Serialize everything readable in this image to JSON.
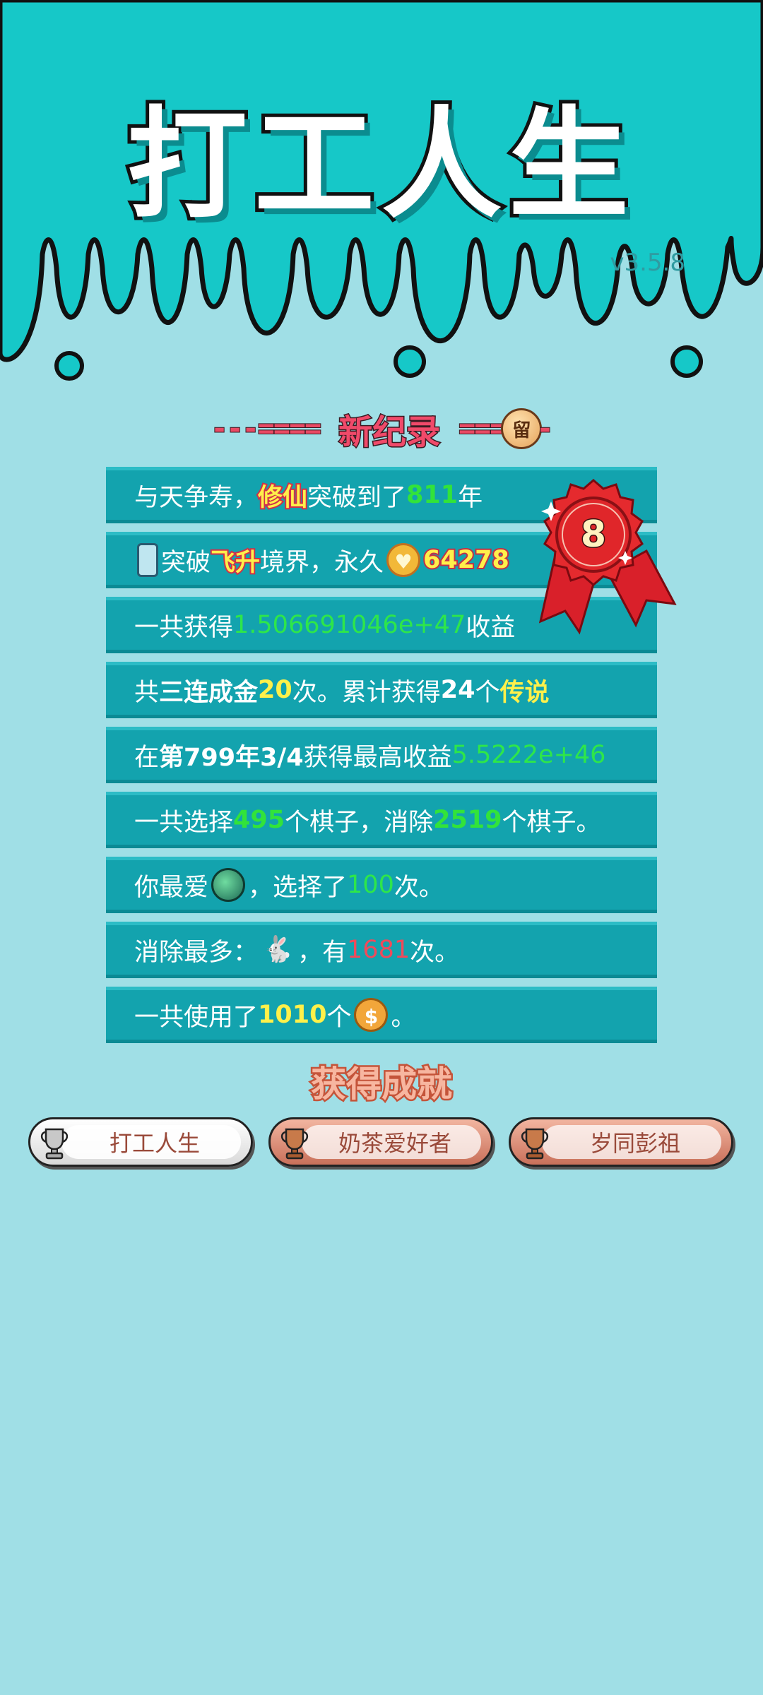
{
  "header": {
    "title": "打工人生",
    "version": "v3.5.8"
  },
  "record": {
    "title": "新纪录",
    "dash_left": "---====",
    "dash_right": "====",
    "dash_tail": "-",
    "coin_glyph": "留"
  },
  "medal": {
    "number": "8"
  },
  "stats": {
    "row1": {
      "pre": "与天争寿，",
      "tag": "修仙",
      "mid": "突破到了",
      "value": "811",
      "post": "年"
    },
    "row2": {
      "pre": "突破",
      "tag": "飞升",
      "mid": "境界，永久",
      "value": "64278"
    },
    "row3": {
      "pre": "一共获得",
      "value": "1.506691046e+47",
      "post": "收益"
    },
    "row4": {
      "pre": "共",
      "bold": "三连成金",
      "count": "20",
      "mid": "次。累计获得",
      "count2": "24",
      "unit": "个",
      "tag": "传说"
    },
    "row5": {
      "pre": "在 ",
      "bold": "第799年3/4",
      "mid": " 获得最高收益",
      "value": "5.5222e+46"
    },
    "row6": {
      "pre": "一共选择",
      "value1": "495",
      "mid": "个棋子，消除",
      "value2": "2519",
      "post": "个棋子。"
    },
    "row7": {
      "pre": "你最爱",
      "mid": "，选择了",
      "value": "100",
      "post": "次。"
    },
    "row8": {
      "pre": "消除最多：",
      "mid": "，有",
      "value": "1681",
      "post": "次。"
    },
    "row9": {
      "pre": "一共使用了",
      "value": "1010",
      "post1": "个",
      "post2": "。"
    }
  },
  "icons": {
    "fridge": "fridge-icon",
    "heart_coin": "heart-coin-icon",
    "planet": "planet-icon",
    "rabbit": "rabbit-icon",
    "dollar_coin": "dollar-coin-icon",
    "heart_glyph": "♥",
    "dollar_glyph": "$",
    "rabbit_glyph": "🐇"
  },
  "achievements": {
    "title": "获得成就",
    "items": [
      {
        "label": "打工人生",
        "tier": "silver"
      },
      {
        "label": "奶茶爱好者",
        "tier": "bronze"
      },
      {
        "label": "岁同彭祖",
        "tier": "bronze"
      }
    ]
  },
  "colors": {
    "background": "#a0dfe6",
    "top_band": "#16c8c8",
    "row_bg": "#13a3ae",
    "green_value": "#32e33a",
    "yellow_value": "#fff04a",
    "red_value": "#f04a5a"
  }
}
